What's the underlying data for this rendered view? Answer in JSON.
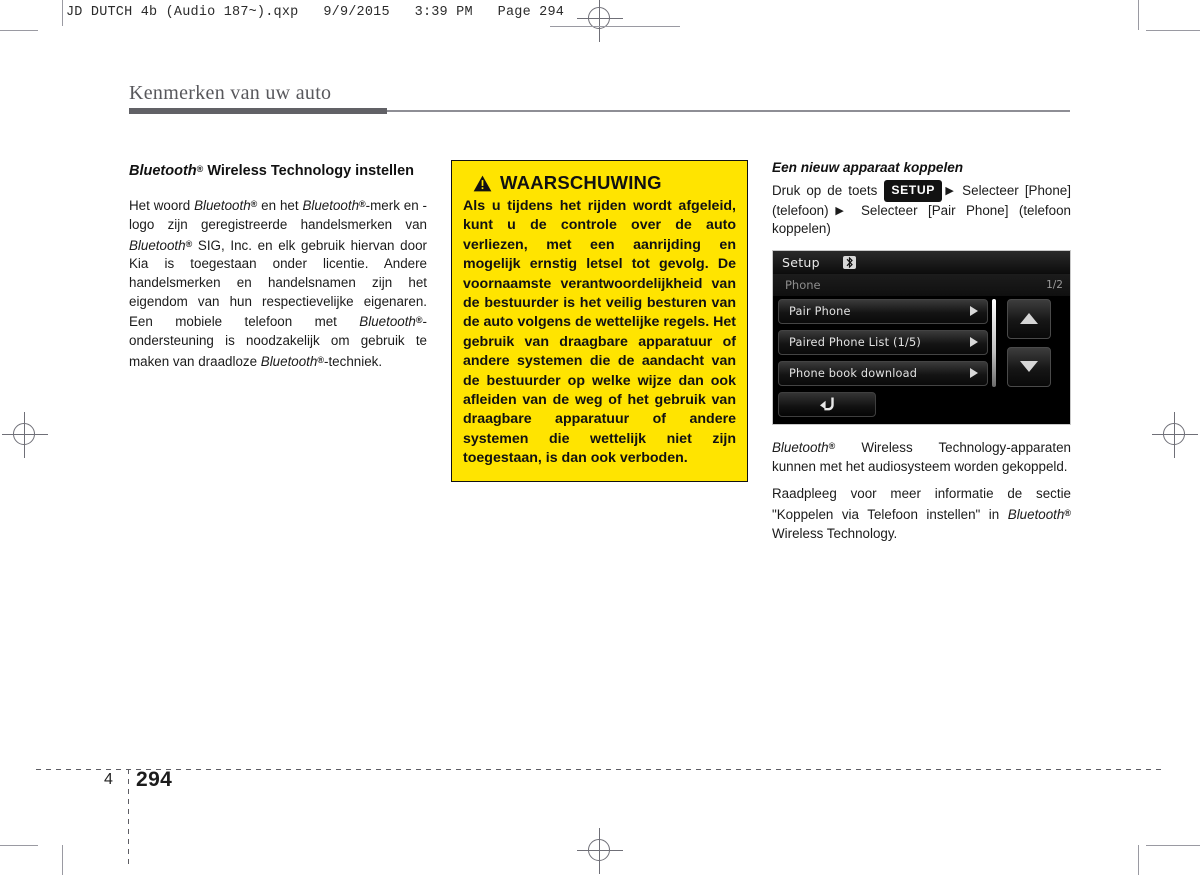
{
  "printer_slug": "JD DUTCH 4b (Audio 187~).qxp   9/9/2015   3:39 PM   Page 294",
  "chapter": {
    "title": "Kenmerken van uw auto",
    "rule_color": "#616166"
  },
  "left_column": {
    "section_heading_part1": "Bluetooth",
    "section_heading_reg": "®",
    "section_heading_part2": " Wireless Technology instellen",
    "paragraph_segments": [
      {
        "text": "Het woord ",
        "style": "normal"
      },
      {
        "text": "Bluetooth",
        "style": "italic"
      },
      {
        "text": "®",
        "style": "reg"
      },
      {
        "text": " en het ",
        "style": "normal"
      },
      {
        "text": "Bluetooth",
        "style": "italic"
      },
      {
        "text": "®",
        "style": "reg"
      },
      {
        "text": "-merk en -logo zijn geregistreerde handelsmerken van ",
        "style": "normal"
      },
      {
        "text": "Bluetooth",
        "style": "italic"
      },
      {
        "text": "®",
        "style": "reg"
      },
      {
        "text": " SIG, Inc. en elk gebruik hiervan door Kia is toegestaan onder licentie. Andere handelsmerken en handelsnamen zijn het eigendom van hun respectievelijke eigenaren. Een mobiele telefoon met ",
        "style": "normal"
      },
      {
        "text": "Bluetooth",
        "style": "italic"
      },
      {
        "text": "®",
        "style": "reg"
      },
      {
        "text": "-ondersteuning is noodzakelijk om gebruik te maken van draadloze ",
        "style": "normal"
      },
      {
        "text": "Bluetooth",
        "style": "italic"
      },
      {
        "text": "®",
        "style": "reg"
      },
      {
        "text": "-techniek.",
        "style": "normal"
      }
    ]
  },
  "warning": {
    "icon": "warning-triangle-icon",
    "title": "WAARSCHUWING",
    "body": "Als u tijdens het rijden wordt afgeleid, kunt u de controle over de auto verliezen, met een aanrijding en mogelijk ernstig letsel tot gevolg. De voornaamste verantwoordelijkheid van de bestuurder is het veilig besturen van de auto volgens de wettelijke regels. Het gebruik van draagbare apparatuur of andere systemen die de aandacht van de bestuurder op welke wijze dan ook afleiden van de weg of het gebruik van draagbare apparatuur of andere systemen die wettelijk niet zijn toegestaan, is dan ook verboden.",
    "background_color": "#ffe400",
    "border_color": "#111111"
  },
  "right_column": {
    "sub_heading": "Een nieuw apparaat koppelen",
    "instruction_pre": "Druk op de toets ",
    "setup_key_label": "SETUP",
    "instruction_post": " Selecteer [Phone] (telefoon)",
    "instruction_post2": " Selecteer [Pair Phone] (telefoon koppelen)",
    "arrow_glyph": "▶",
    "paragraph2_segments": [
      {
        "text": "Bluetooth",
        "style": "italic"
      },
      {
        "text": "®",
        "style": "reg"
      },
      {
        "text": " Wireless Technology-apparaten kunnen met het audiosysteem worden gekoppeld.",
        "style": "normal"
      }
    ],
    "paragraph3_segments": [
      {
        "text": "Raadpleeg voor meer informatie de sectie \"Koppelen via Telefoon instellen\" in ",
        "style": "normal"
      },
      {
        "text": "Bluetooth",
        "style": "italic"
      },
      {
        "text": "®",
        "style": "reg"
      },
      {
        "text": " Wireless Technology.",
        "style": "normal"
      }
    ]
  },
  "device_screenshot": {
    "title": "Setup",
    "title_icon": "bluetooth-icon",
    "sub_label": "Phone",
    "page_indicator": "1/2",
    "rows": [
      {
        "label": "Pair Phone",
        "arrow": "chevron-right-icon"
      },
      {
        "label": "Paired Phone List  (1/5)",
        "arrow": "chevron-right-icon"
      },
      {
        "label": "Phone book download",
        "arrow": "chevron-right-icon"
      }
    ],
    "scroll_up": "triangle-up-icon",
    "scroll_down": "triangle-down-icon",
    "back_button": "back-arrow-icon"
  },
  "footer": {
    "chapter_number": "4",
    "page_number": "294"
  }
}
